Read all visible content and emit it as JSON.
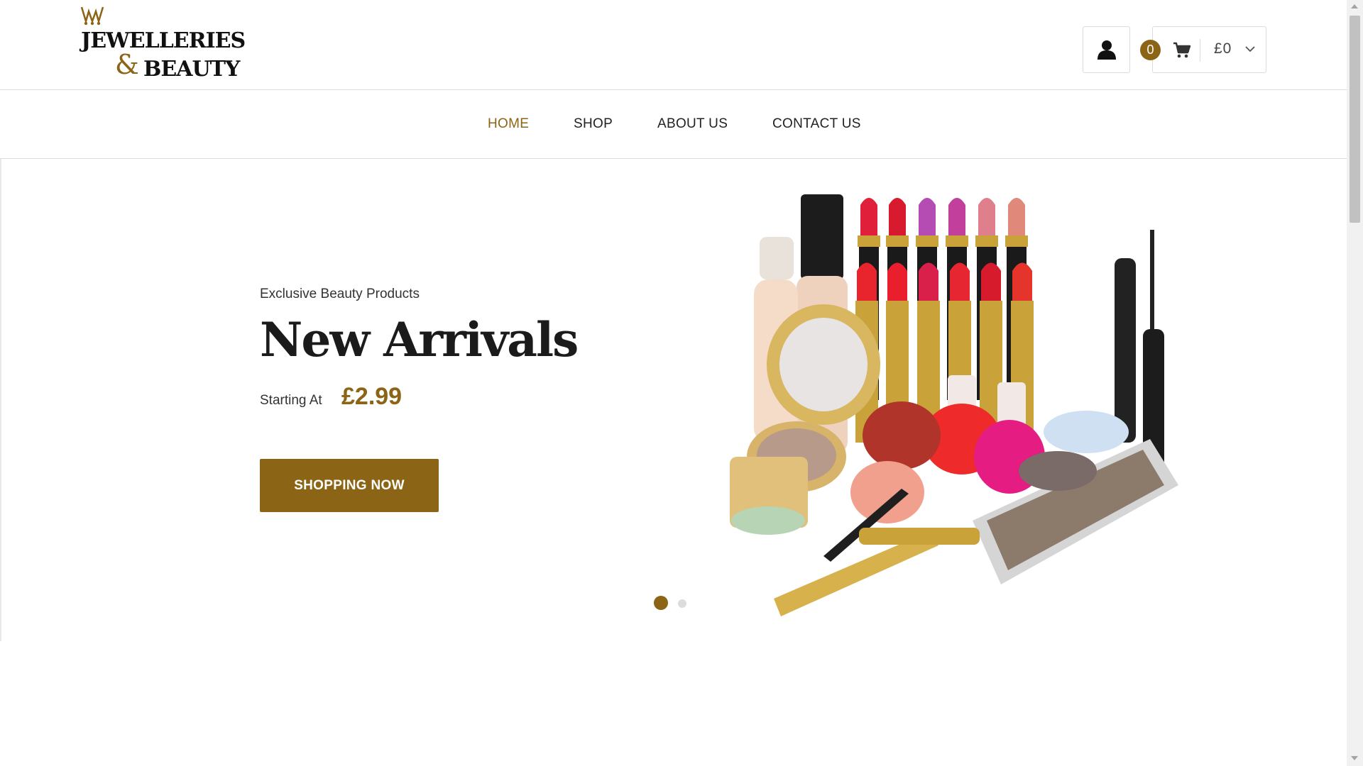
{
  "brand": {
    "name_line1": "JEWELLERIES",
    "ampersand": "&",
    "name_line2": "BEAUTY",
    "accent_color": "#8c6415"
  },
  "header": {
    "account_icon": "user-icon",
    "cart": {
      "count": "0",
      "icon": "cart-icon",
      "total": "£0",
      "dropdown_icon": "chevron-down-icon"
    }
  },
  "nav": {
    "items": [
      {
        "label": "HOME",
        "active": true
      },
      {
        "label": "SHOP",
        "active": false
      },
      {
        "label": "ABOUT US",
        "active": false
      },
      {
        "label": "CONTACT US",
        "active": false
      }
    ]
  },
  "hero": {
    "eyebrow": "Exclusive Beauty Products",
    "title": "New Arrivals",
    "starting_label": "Starting At",
    "price": "£2.99",
    "cta_label": "SHOPPING NOW",
    "image": "cosmetics-assortment-image",
    "slides": {
      "total": 2,
      "active": 1
    }
  }
}
